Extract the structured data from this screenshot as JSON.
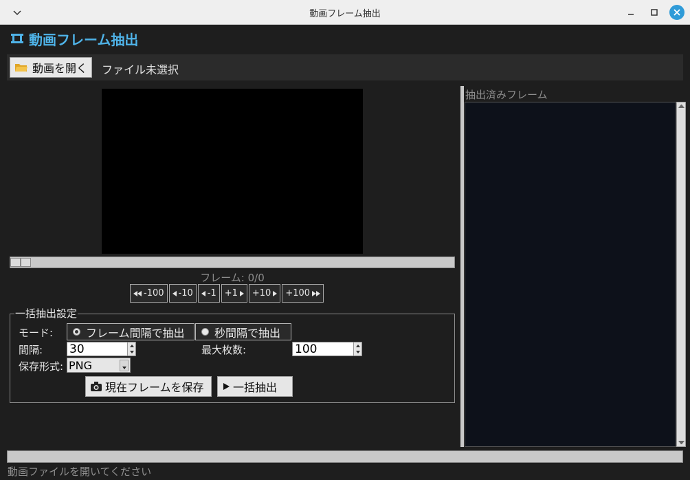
{
  "window": {
    "title": "動画フレーム抽出"
  },
  "header": {
    "title": "動画フレーム抽出",
    "icon": "film-strip-icon"
  },
  "toolbar": {
    "open_label": "動画を開く",
    "file_status": "ファイル未選択"
  },
  "seek": {
    "position": 0
  },
  "frame": {
    "label": "フレーム: 0/0"
  },
  "nav_buttons": [
    "-100",
    "-10",
    "-1",
    "+1",
    "+10",
    "+100"
  ],
  "batch": {
    "title": "一括抽出設定",
    "mode_label": "モード:",
    "mode_options": [
      "フレーム間隔で抽出",
      "秒間隔で抽出"
    ],
    "selected_mode": 0,
    "interval_label": "間隔:",
    "interval_value": "30",
    "max_label": "最大枚数:",
    "max_value": "100",
    "format_label": "保存形式:",
    "format_value": "PNG",
    "save_current_label": "現在フレームを保存",
    "extract_label": "一括抽出"
  },
  "extracted": {
    "title": "抽出済みフレーム"
  },
  "progress": {
    "value": 0
  },
  "status": {
    "text": "動画ファイルを開いてください"
  },
  "colors": {
    "accent": "#4fb3e8",
    "background": "#1e1e1e",
    "list_bg": "#0d111a"
  }
}
